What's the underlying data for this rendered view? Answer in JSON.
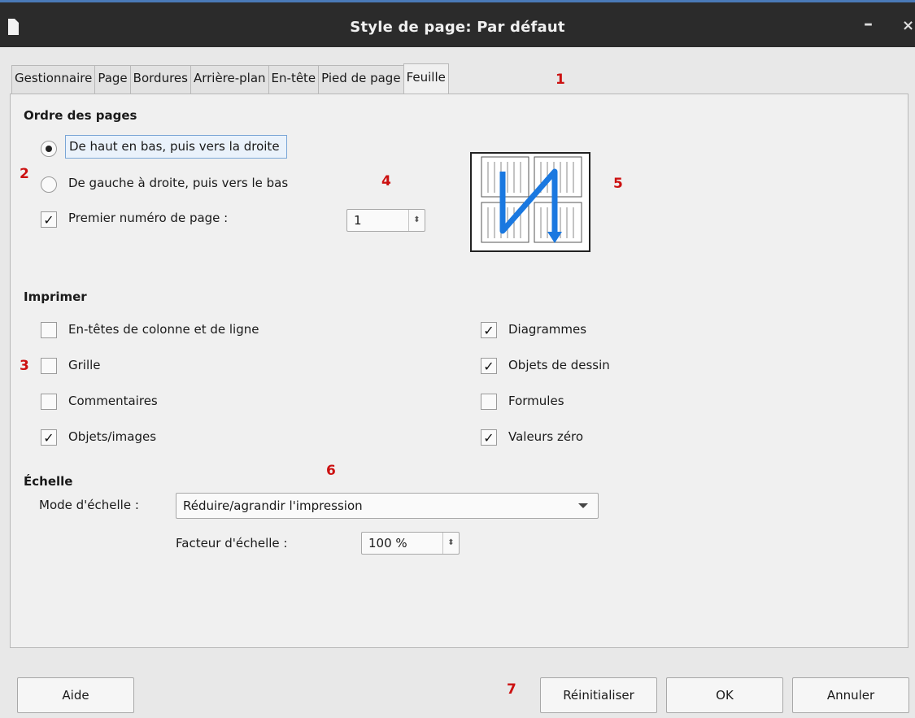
{
  "window": {
    "title": "Style de page: Par défaut",
    "minimize_glyph": "–",
    "close_glyph": "×"
  },
  "tabs": [
    "Gestionnaire",
    "Page",
    "Bordures",
    "Arrière-plan",
    "En-tête",
    "Pied de page",
    "Feuille"
  ],
  "active_tab": "Feuille",
  "page_order": {
    "title": "Ordre des pages",
    "options": [
      {
        "label": "De haut en bas, puis vers la droite",
        "selected": true
      },
      {
        "label": "De gauche à droite, puis vers le bas",
        "selected": false
      }
    ],
    "first_page": {
      "label": "Premier numéro de page :",
      "checked": true,
      "value": "1"
    }
  },
  "print": {
    "title": "Imprimer",
    "left": [
      {
        "label": "En-têtes de colonne et de ligne",
        "checked": false
      },
      {
        "label": "Grille",
        "checked": false
      },
      {
        "label": "Commentaires",
        "checked": false
      },
      {
        "label": "Objets/images",
        "checked": true
      }
    ],
    "right": [
      {
        "label": "Diagrammes",
        "checked": true
      },
      {
        "label": "Objets de dessin",
        "checked": true
      },
      {
        "label": "Formules",
        "checked": false
      },
      {
        "label": "Valeurs zéro",
        "checked": true
      }
    ]
  },
  "scale": {
    "title": "Échelle",
    "mode_label": "Mode d'échelle :",
    "mode_value": "Réduire/agrandir l'impression",
    "factor_label": "Facteur d'échelle :",
    "factor_value": "100 %"
  },
  "markers": [
    "1",
    "2",
    "3",
    "4",
    "5",
    "6",
    "7"
  ],
  "buttons": {
    "help": "Aide",
    "reset": "Réinitialiser",
    "ok": "OK",
    "cancel": "Annuler"
  },
  "colors": {
    "marker": "#cc1111",
    "arrow": "#1a78e0",
    "titlebar": "#2b2b2b"
  },
  "icons": {
    "checkmark": "✓",
    "spin": "⬍"
  }
}
